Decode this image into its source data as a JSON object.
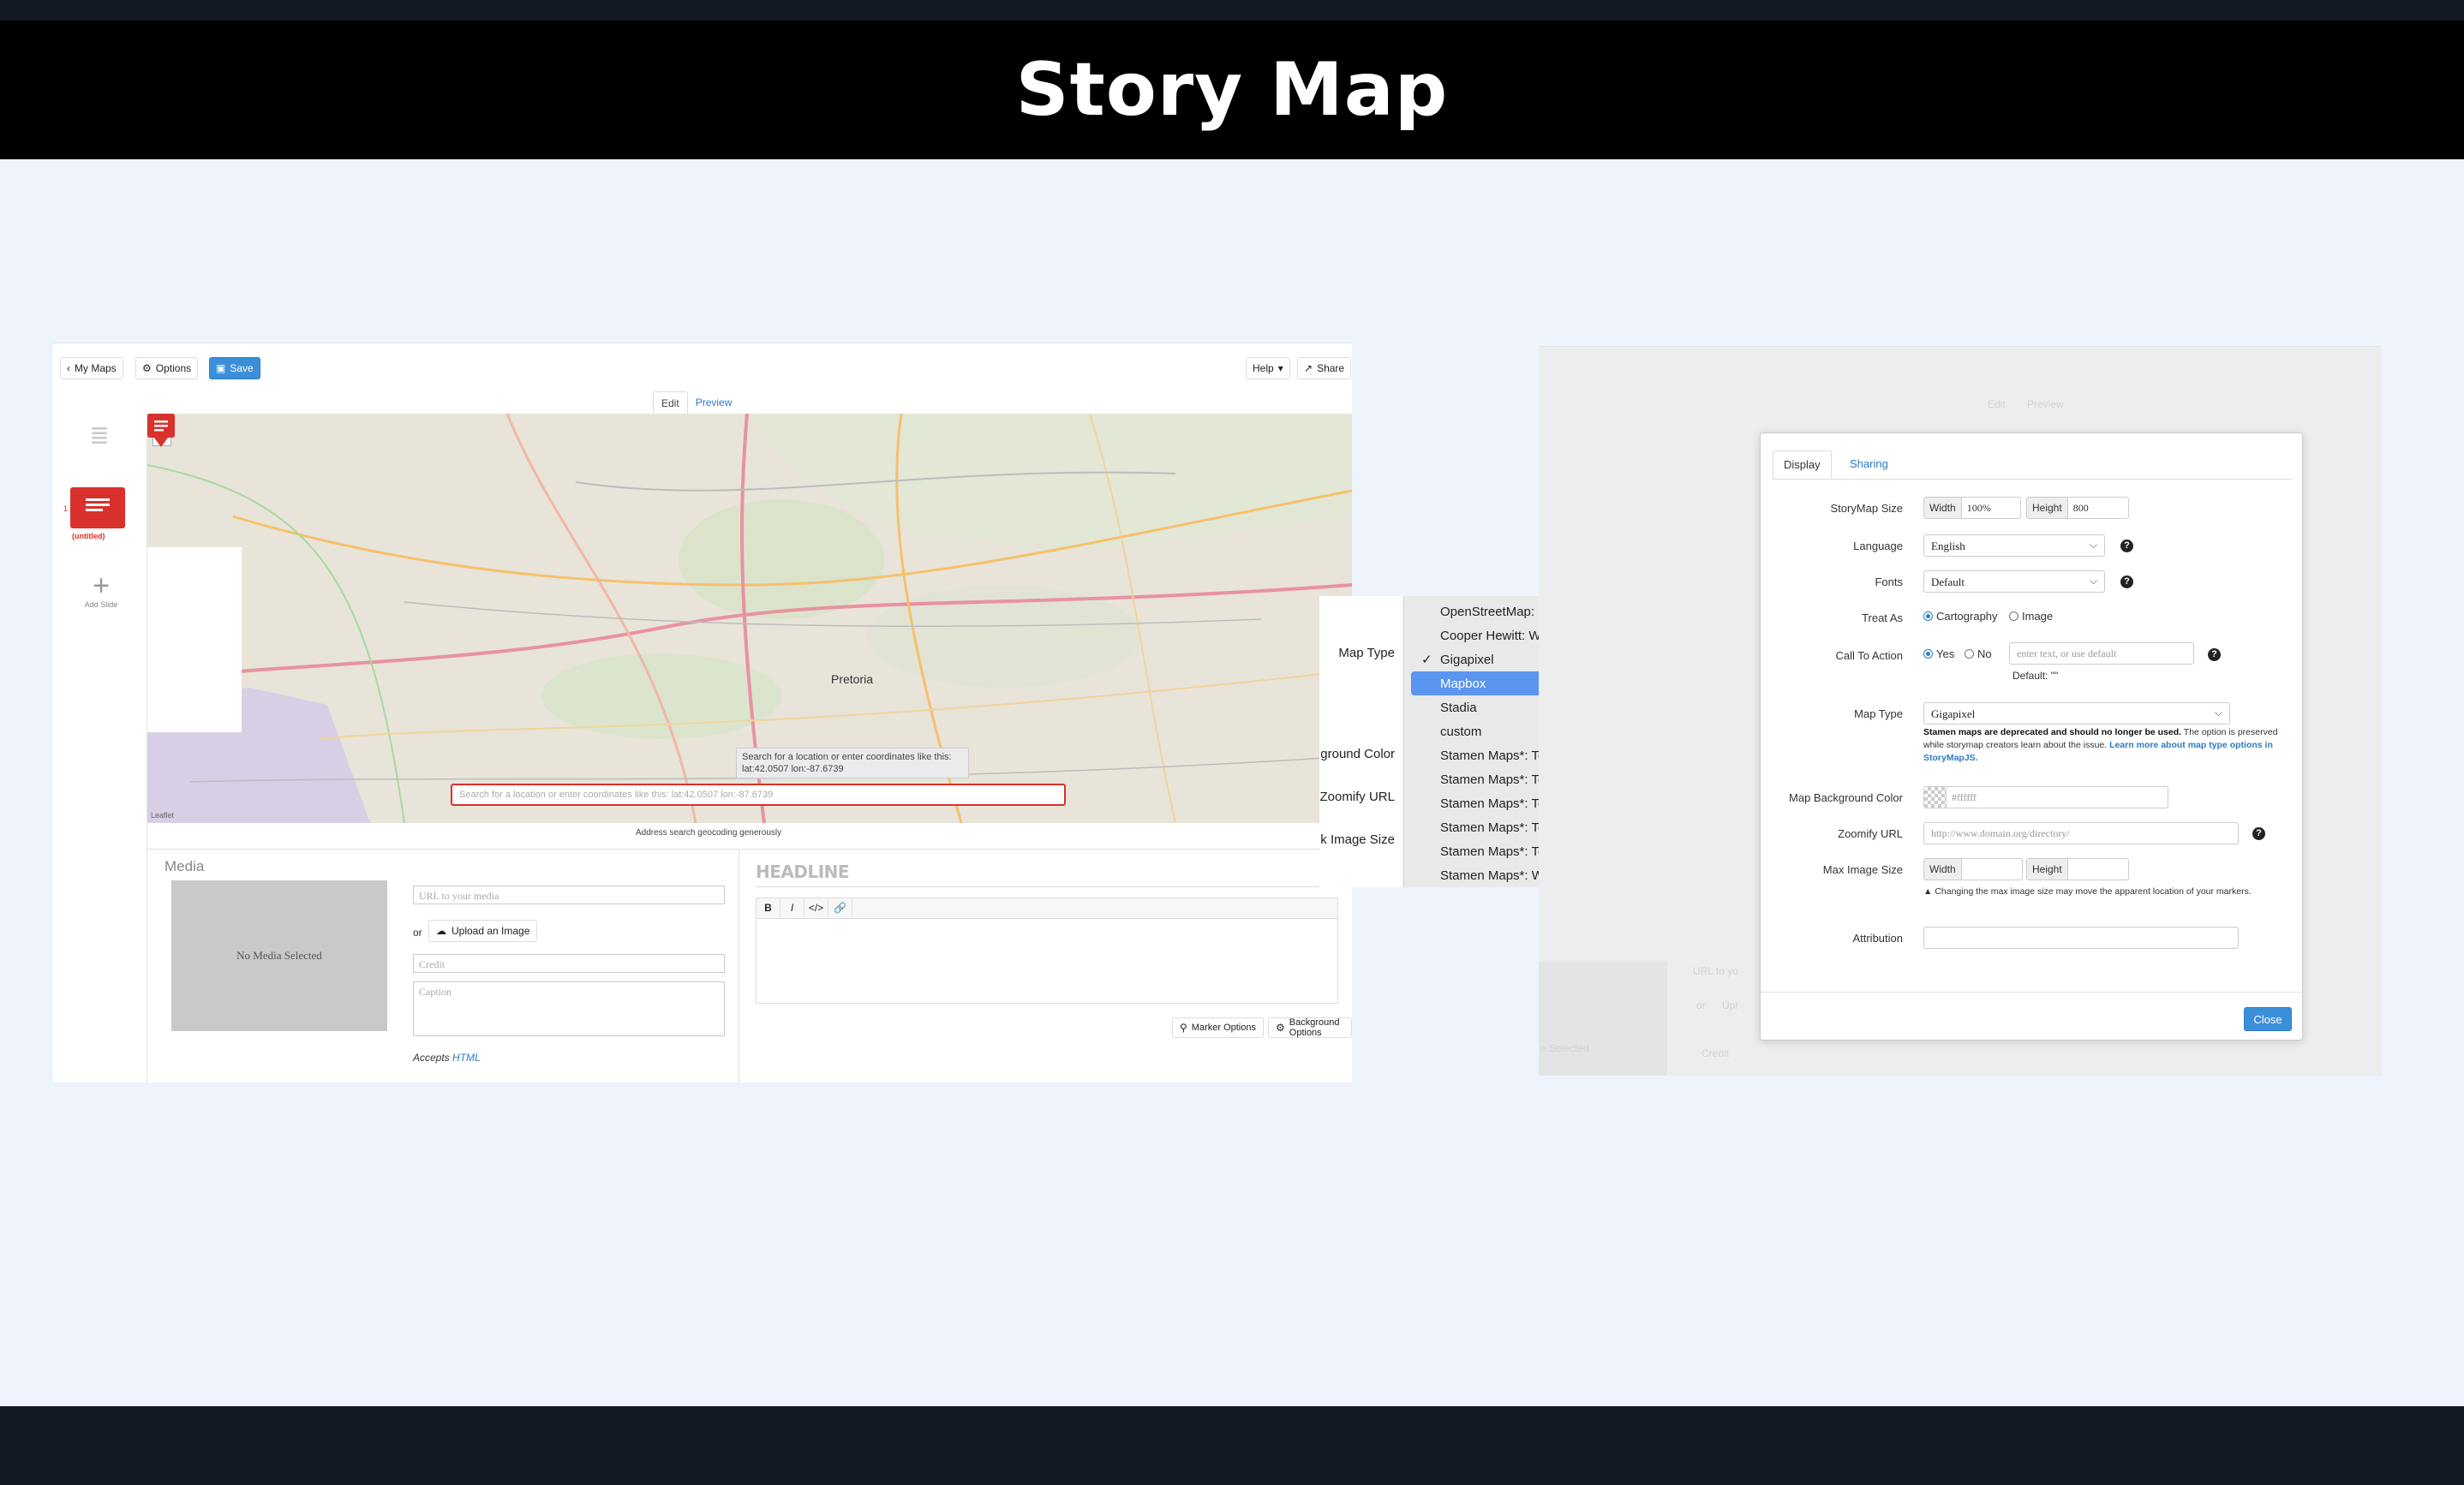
{
  "page": {
    "title": "Story Map"
  },
  "left": {
    "toolbar": {
      "my_maps": "My Maps",
      "options": "Options",
      "save": "Save",
      "help": "Help",
      "share": "Share"
    },
    "view_tabs": {
      "edit": "Edit",
      "preview": "Preview"
    },
    "slides": {
      "number": "1",
      "title": "(untitled)",
      "add_label": "Add Slide"
    },
    "map": {
      "search_placeholder": "Search for a location or enter coordinates like this: lat:42.0507 lon:-87.6739",
      "tooltip": "Search for a location or enter coordinates like this: lat:42.0507 lon:-87.6739",
      "leaflet": "Leaflet",
      "geocoding_note": "Address search geocoding generously",
      "marker_city": "Pretoria"
    },
    "media": {
      "heading": "Media",
      "no_media": "No Media Selected",
      "url_placeholder": "URL to your media",
      "or": "or",
      "upload": "Upload an Image",
      "credit_placeholder": "Credit",
      "caption_placeholder": "Caption",
      "accepts": "Accepts",
      "accepts_link": "HTML"
    },
    "text": {
      "headline_placeholder": "HEADLINE",
      "rte": {
        "bold": "B",
        "italic": "I",
        "code": "</>",
        "link": "🔗"
      },
      "marker_options": "Marker Options",
      "background_options": "Background Options"
    }
  },
  "dropdown": {
    "side_labels": [
      "Map Type",
      "ground Color",
      "Zoomify URL",
      "k Image Size"
    ],
    "items": [
      {
        "label": "OpenStreetMap: Standard",
        "checked": false,
        "highlighted": false
      },
      {
        "label": "Cooper Hewitt: Watercolor",
        "checked": false,
        "highlighted": false
      },
      {
        "label": "Gigapixel",
        "checked": true,
        "highlighted": false
      },
      {
        "label": "Mapbox",
        "checked": false,
        "highlighted": true
      },
      {
        "label": "Stadia",
        "checked": false,
        "highlighted": false
      },
      {
        "label": "custom",
        "checked": false,
        "highlighted": false
      },
      {
        "label": "Stamen Maps*: Toner Lite",
        "checked": false,
        "highlighted": false
      },
      {
        "label": "Stamen Maps*: Toner",
        "checked": false,
        "highlighted": false
      },
      {
        "label": "Stamen Maps*: Toner Lines",
        "checked": false,
        "highlighted": false
      },
      {
        "label": "Stamen Maps*: Toner Labels",
        "checked": false,
        "highlighted": false
      },
      {
        "label": "Stamen Maps*: Toner Background",
        "checked": false,
        "highlighted": false
      },
      {
        "label": "Stamen Maps*: Watercolor",
        "checked": false,
        "highlighted": false
      }
    ],
    "check_glyph": "✓",
    "highlight_color": "#5a95f0"
  },
  "right": {
    "background": {
      "edit": "Edit",
      "preview": "Preview",
      "url_hint": "URL to yo",
      "or": "or",
      "upload_hint": "Upl",
      "selected_hint": "e Selected",
      "credit_hint": "Credit"
    },
    "modal": {
      "tabs": {
        "display": "Display",
        "sharing": "Sharing"
      },
      "size": {
        "label": "StoryMap Size",
        "width_label": "Width",
        "width_value": "100%",
        "height_label": "Height",
        "height_value": "800"
      },
      "language": {
        "label": "Language",
        "value": "English"
      },
      "fonts": {
        "label": "Fonts",
        "value": "Default"
      },
      "treat_as": {
        "label": "Treat As",
        "option1": "Cartography",
        "option2": "Image",
        "selected": "Cartography"
      },
      "cta": {
        "label": "Call To Action",
        "yes": "Yes",
        "no": "No",
        "placeholder": "enter text, or use default",
        "default_note": "Default: \"\""
      },
      "map_type": {
        "label": "Map Type",
        "value": "Gigapixel",
        "note_bold": "Stamen maps are deprecated and should no longer be used.",
        "note_text": " The option is preserved while storymap creators learn about the issue. ",
        "note_link": "Learn more about map type options in StoryMapJS."
      },
      "bg_color": {
        "label": "Map Background Color",
        "value": "#ffffff"
      },
      "zoomify": {
        "label": "Zoomify URL",
        "placeholder": "http://www.domain.org/directory/"
      },
      "max_image": {
        "label": "Max Image Size",
        "width_label": "Width",
        "height_label": "Height",
        "warning": "Changing the max image size may move the apparent location of your markers."
      },
      "attribution": {
        "label": "Attribution"
      },
      "close": "Close"
    }
  },
  "colors": {
    "accent": "#3b8fd9",
    "marker": "#d9312b",
    "title_bg": "#000000"
  }
}
